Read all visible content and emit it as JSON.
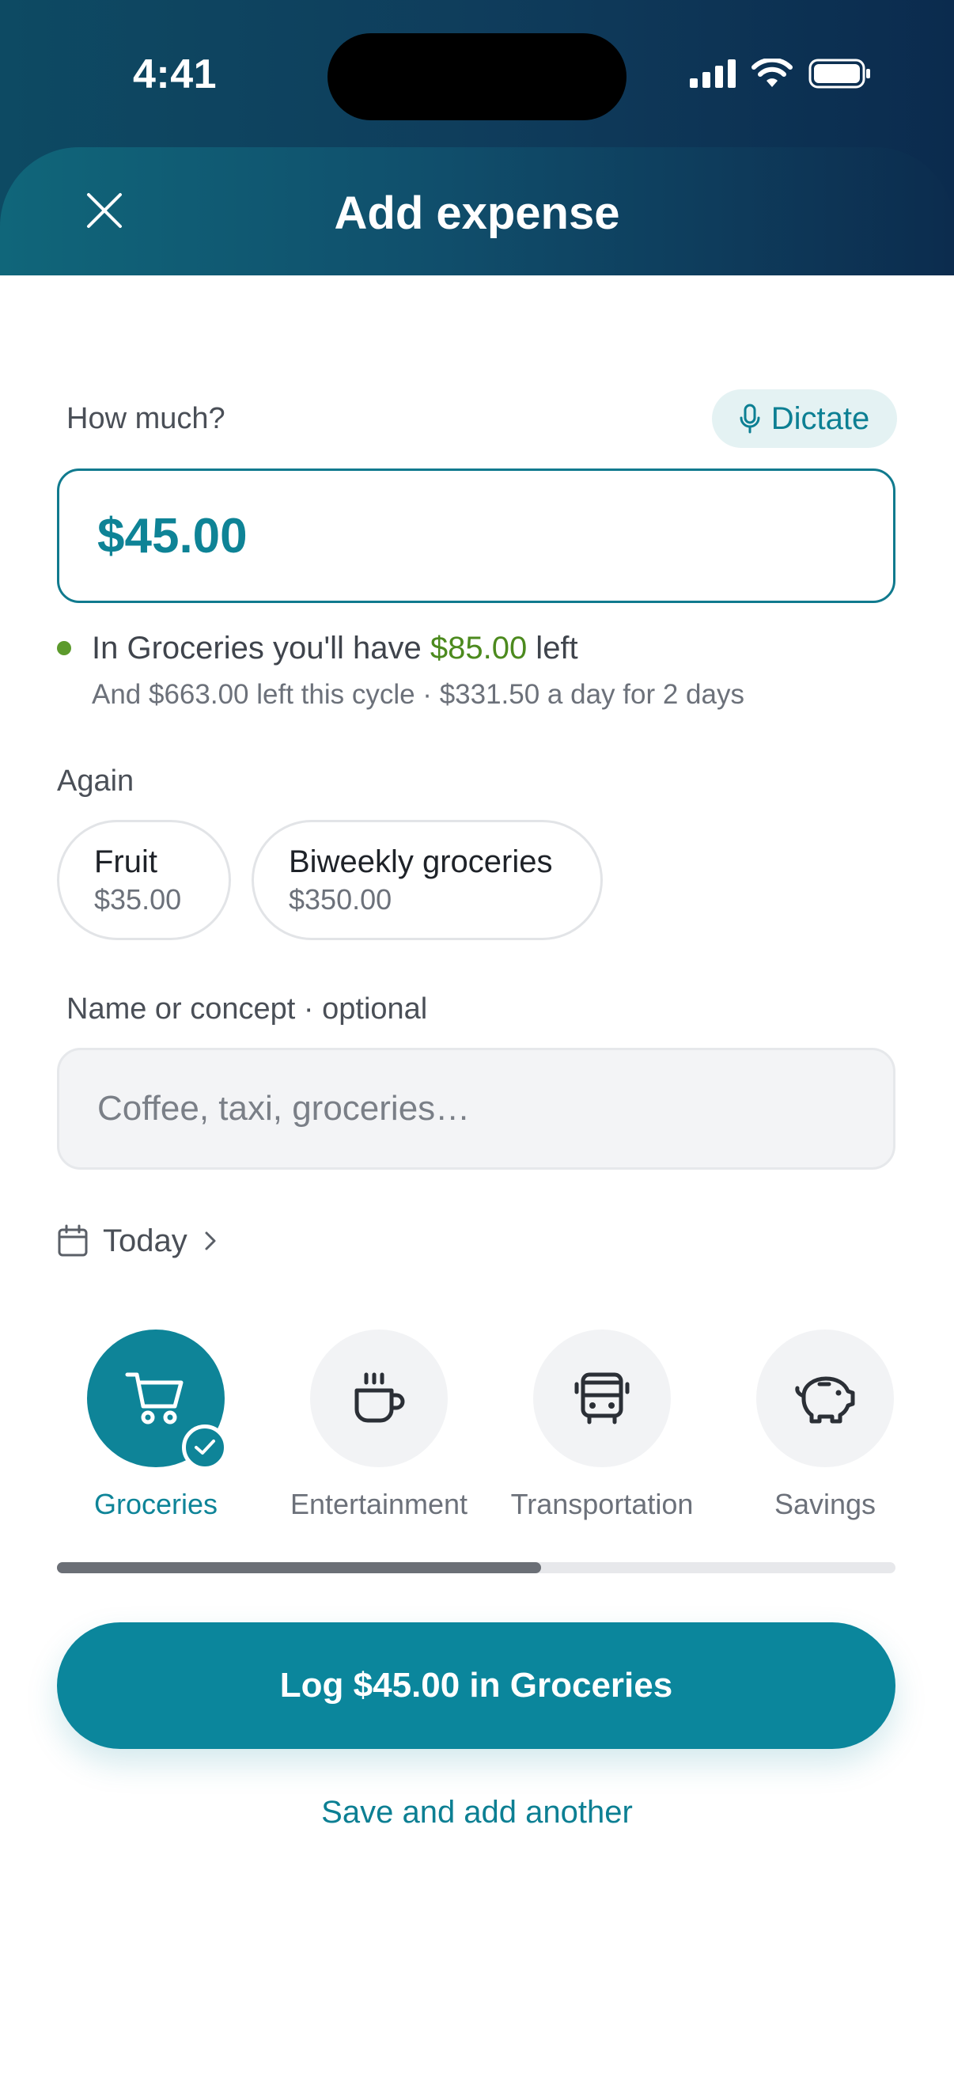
{
  "status_bar": {
    "time": "4:41"
  },
  "header": {
    "title": "Add expense",
    "close_icon": "close-icon"
  },
  "amount": {
    "label": "How much?",
    "dictate_label": "Dictate",
    "value": "$45.00"
  },
  "budget_info": {
    "prefix": "In Groceries you'll have ",
    "remaining": "$85.00",
    "suffix": " left",
    "cycle_note": "And $663.00 left this cycle · $331.50 a day for 2 days"
  },
  "again": {
    "label": "Again",
    "items": [
      {
        "name": "Fruit",
        "amount": "$35.00"
      },
      {
        "name": "Biweekly groceries",
        "amount": "$350.00"
      }
    ]
  },
  "name_field": {
    "label": "Name or concept · optional",
    "placeholder": "Coffee, taxi, groceries…"
  },
  "date": {
    "label": "Today"
  },
  "categories": {
    "items": [
      {
        "label": "Groceries",
        "icon": "cart-icon",
        "selected": true
      },
      {
        "label": "Entertainment",
        "icon": "coffee-icon",
        "selected": false
      },
      {
        "label": "Transportation",
        "icon": "bus-icon",
        "selected": false
      },
      {
        "label": "Savings",
        "icon": "piggy-bank-icon",
        "selected": false
      }
    ]
  },
  "actions": {
    "primary": "Log $45.00 in Groceries",
    "secondary": "Save and add another"
  },
  "colors": {
    "accent": "#0b869c",
    "positive": "#4c8a1e",
    "header_gradient_start": "#10667a",
    "header_gradient_end": "#0c2c4e"
  }
}
